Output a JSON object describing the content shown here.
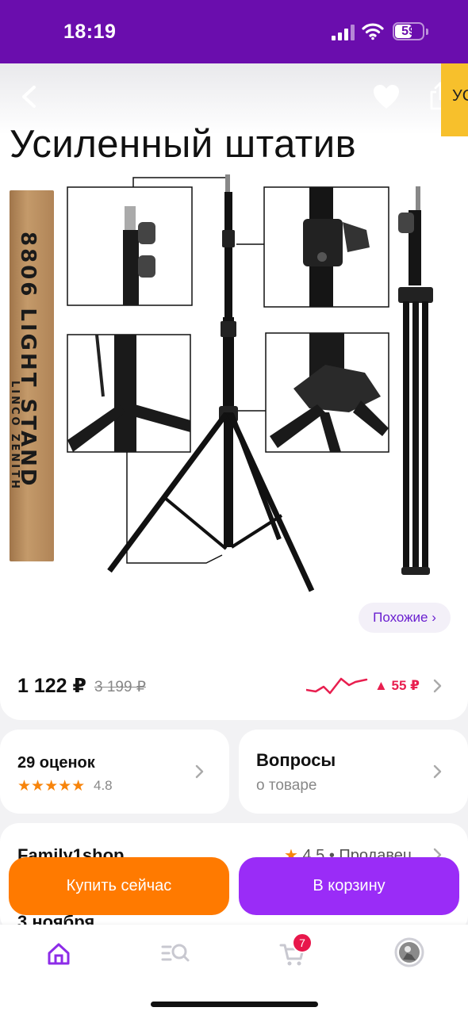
{
  "status_bar": {
    "time": "18:19",
    "battery": "59",
    "icons": [
      "cellular-signal-icon",
      "wifi-icon",
      "battery-icon"
    ]
  },
  "header": {
    "back_icon": "chevron-left-icon",
    "favorite_icon": "heart-icon",
    "share_icon": "share-icon",
    "side_tab_text": "УС"
  },
  "product_image": {
    "headline": "Усиленный штатив",
    "box_text": "8806 LIGHT STAND",
    "box_subtext": "LINCO ZENITH"
  },
  "similar_button": {
    "label": "Похожие ›"
  },
  "price": {
    "current": "1 122 ₽",
    "old": "3 199 ₽",
    "delta": "▲ 55 ₽",
    "trend_color": "#e81f4f"
  },
  "rating_card": {
    "title": "29 оценок",
    "stars": "★★★★★",
    "score": "4.8"
  },
  "questions_card": {
    "title": "Вопросы",
    "subtitle": "о товаре"
  },
  "seller_card": {
    "name": "Family1shop",
    "rating_star": "★",
    "rating": "4.5 • Продавец",
    "delivery": "3 ноября"
  },
  "actions": {
    "buy_now": "Купить сейчас",
    "add_to_cart": "В корзину"
  },
  "bottom_nav": {
    "items": [
      "home-icon",
      "catalog-search-icon",
      "cart-icon",
      "profile-avatar"
    ],
    "cart_count": "7"
  },
  "colors": {
    "brand": "#6a0dad",
    "orange": "#ff7a00",
    "purple_button": "#9a2cf7",
    "price_delta": "#e81f4f",
    "star": "#f7840b"
  }
}
